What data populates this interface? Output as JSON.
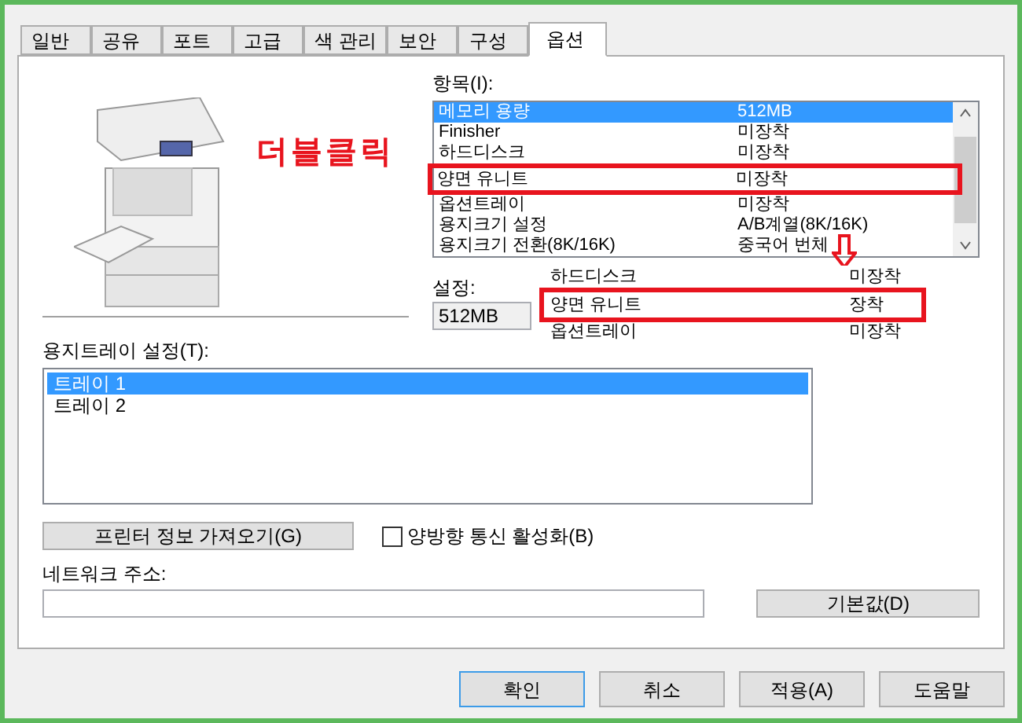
{
  "tabs": [
    {
      "label": "일반",
      "selected": false
    },
    {
      "label": "공유",
      "selected": false
    },
    {
      "label": "포트",
      "selected": false
    },
    {
      "label": "고급",
      "selected": false
    },
    {
      "label": "색 관리",
      "selected": false
    },
    {
      "label": "보안",
      "selected": false
    },
    {
      "label": "구성",
      "selected": false
    },
    {
      "label": "옵션",
      "selected": true
    }
  ],
  "annotation": {
    "text": "더블클릭"
  },
  "items": {
    "label": "항목(I):",
    "rows": [
      {
        "name": "메모리 용량",
        "value": "512MB",
        "selected": true,
        "highlighted": false
      },
      {
        "name": "Finisher",
        "value": "미장착",
        "selected": false,
        "highlighted": false
      },
      {
        "name": "하드디스크",
        "value": "미장착",
        "selected": false,
        "highlighted": false
      },
      {
        "name": "양면 유니트",
        "value": "미장착",
        "selected": false,
        "highlighted": true
      },
      {
        "name": "옵션트레이",
        "value": "미장착",
        "selected": false,
        "highlighted": false
      },
      {
        "name": "용지크기 설정",
        "value": "A/B계열(8K/16K)",
        "selected": false,
        "highlighted": false
      },
      {
        "name": "용지크기 전환(8K/16K)",
        "value": "중국어 번체",
        "selected": false,
        "highlighted": false
      }
    ]
  },
  "setting": {
    "label": "설정:",
    "value": "512MB"
  },
  "popup": {
    "rows": [
      {
        "name": "하드디스크",
        "value": "미장착",
        "highlighted": false
      },
      {
        "name": "양면 유니트",
        "value": "장착",
        "highlighted": true
      },
      {
        "name": "옵션트레이",
        "value": "미장착",
        "highlighted": false
      }
    ]
  },
  "trays": {
    "label": "용지트레이 설정(T):",
    "rows": [
      {
        "name": "트레이 1",
        "selected": true
      },
      {
        "name": "트레이 2",
        "selected": false
      }
    ]
  },
  "fetch_button": "프린터 정보 가져오기(G)",
  "bidirectional": {
    "label": "양방향 통신 활성화(B)",
    "checked": false
  },
  "network": {
    "label": "네트워크 주소:"
  },
  "default_button": "기본값(D)",
  "buttons": [
    "확인",
    "취소",
    "적용(A)",
    "도움말"
  ]
}
